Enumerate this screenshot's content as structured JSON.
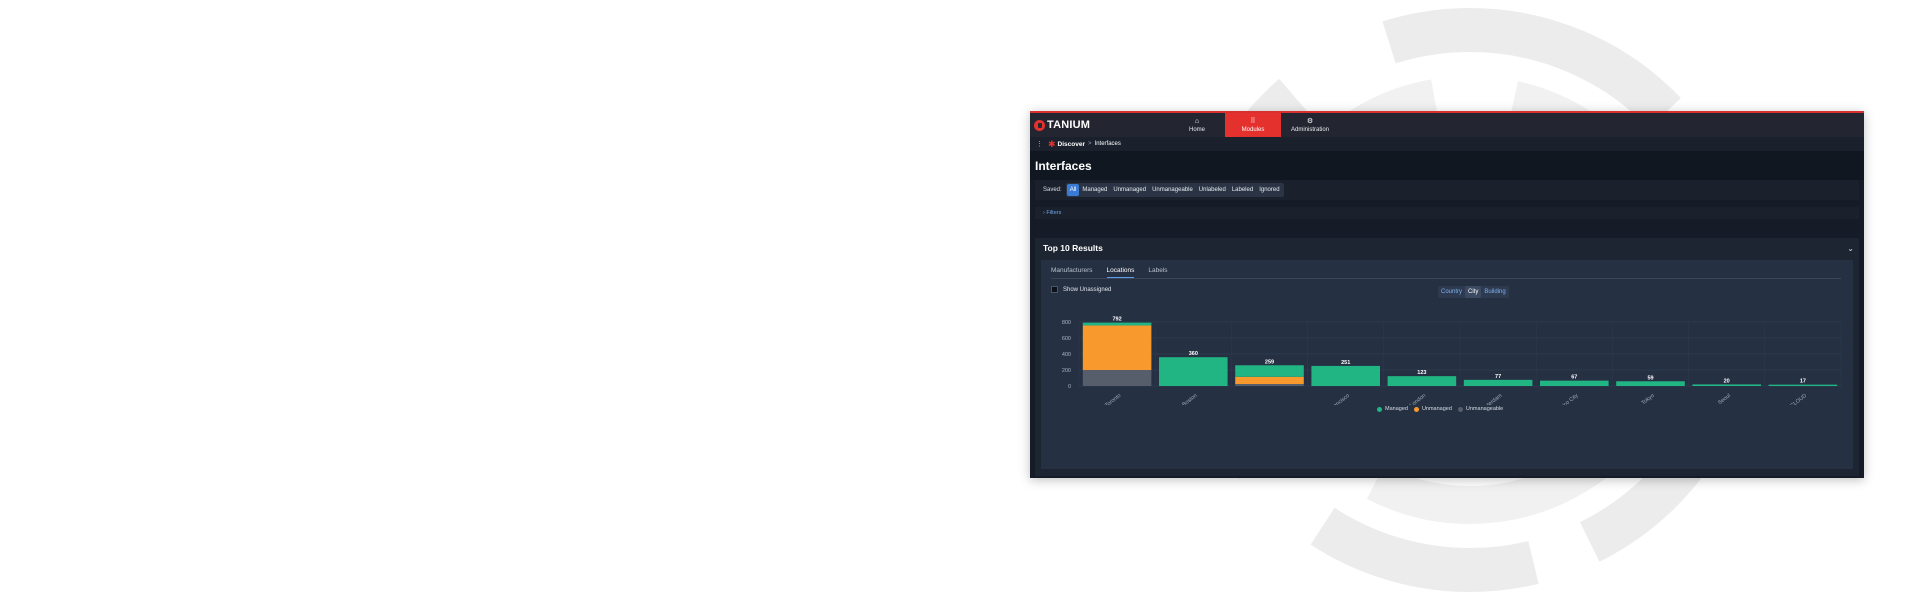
{
  "app": {
    "brand": "TANIUM",
    "nav": [
      {
        "label": "Home",
        "icon": "house-icon"
      },
      {
        "label": "Modules",
        "icon": "grid-icon",
        "active": true
      },
      {
        "label": "Administration",
        "icon": "gears-icon"
      }
    ],
    "accent_color": "#e5312d"
  },
  "breadcrumb": {
    "module": "Discover",
    "separator": ">",
    "current": "Interfaces"
  },
  "page": {
    "title": "Interfaces"
  },
  "saved": {
    "label": "Saved:",
    "chips": [
      "All",
      "Managed",
      "Unmanaged",
      "Unmanageable",
      "Unlabeled",
      "Labeled",
      "Ignored"
    ],
    "active": "All"
  },
  "filters": {
    "label": "Filters"
  },
  "top10": {
    "title": "Top 10 Results",
    "tabs": [
      "Manufacturers",
      "Locations",
      "Labels"
    ],
    "active_tab": "Locations",
    "show_unassigned_label": "Show Unassigned",
    "show_unassigned_checked": false,
    "group_by": [
      "Country",
      "City",
      "Building"
    ],
    "active_group": "City"
  },
  "chart_data": {
    "type": "bar",
    "stacked": true,
    "categories": [
      "Toronto",
      "Boston",
      "",
      "San Francisco",
      "London",
      "Amsterdam",
      "Mexico City",
      "Tokyo",
      "Seoul",
      "CLOUD"
    ],
    "series": [
      {
        "name": "Unmanageable",
        "color": "#565e6b",
        "values": [
          200,
          0,
          25,
          0,
          0,
          0,
          0,
          0,
          0,
          0
        ]
      },
      {
        "name": "Unmanaged",
        "color": "#f7992d",
        "values": [
          557,
          0,
          90,
          0,
          0,
          0,
          0,
          0,
          0,
          0
        ]
      },
      {
        "name": "Managed",
        "color": "#21b584",
        "values": [
          35,
          360,
          144,
          251,
          123,
          77,
          67,
          59,
          20,
          17
        ]
      }
    ],
    "totals": [
      792,
      360,
      259,
      251,
      123,
      77,
      67,
      59,
      20,
      17
    ],
    "y_ticks": [
      0,
      200,
      400,
      600,
      800
    ],
    "ylim": [
      0,
      800
    ],
    "grid": true,
    "legend_position": "bottom-center"
  }
}
